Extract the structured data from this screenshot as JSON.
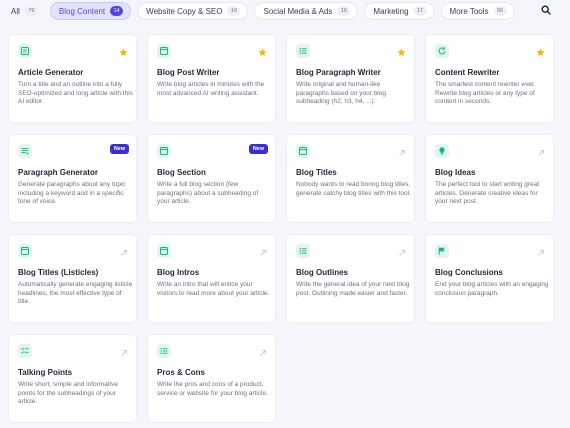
{
  "filters": [
    {
      "label": "All",
      "count": "79",
      "active": false
    },
    {
      "label": "Blog Content",
      "count": "14",
      "active": true
    },
    {
      "label": "Website Copy & SEO",
      "count": "16",
      "active": false
    },
    {
      "label": "Social Media & Ads",
      "count": "16",
      "active": false
    },
    {
      "label": "Marketing",
      "count": "17",
      "active": false
    },
    {
      "label": "More Tools",
      "count": "56",
      "active": false
    }
  ],
  "colors": {
    "accent": "#4f46e5",
    "star": "#f5b400",
    "icon_green": "#10b981",
    "badge": "#3b2fd4"
  },
  "badge_new_label": "New",
  "cards": [
    {
      "title": "Article Generator",
      "desc": "Turn a title and an outline into a fully SEO-optimized and long article with this AI editor.",
      "icon": "document-icon",
      "corner": "star"
    },
    {
      "title": "Blog Post Writer",
      "desc": "Write blog articles in minutes with the most advanced AI writing assistant.",
      "icon": "window-icon",
      "corner": "star"
    },
    {
      "title": "Blog Paragraph Writer",
      "desc": "Write original and human-like paragraphs based on your blog subheading (h2, h3, h4, ...).",
      "icon": "list-icon",
      "corner": "star"
    },
    {
      "title": "Content Rewriter",
      "desc": "The smartest content rewriter ever. Rewrite blog articles or any type of content in seconds.",
      "icon": "refresh-icon",
      "corner": "star"
    },
    {
      "title": "Paragraph Generator",
      "desc": "Generate paragraphs about any topic including a keyword and in a specific tone of voice.",
      "icon": "paragraph-icon",
      "corner": "new"
    },
    {
      "title": "Blog Section",
      "desc": "Write a full blog section (few paragraphs) about a subheading of your article.",
      "icon": "window-icon",
      "corner": "new"
    },
    {
      "title": "Blog Titles",
      "desc": "Nobody wants to read boring blog titles, generate catchy blog titles with this tool.",
      "icon": "window-icon",
      "corner": "arrow"
    },
    {
      "title": "Blog Ideas",
      "desc": "The perfect tool to start writing great articles. Generate creative ideas for your next post.",
      "icon": "bulb-icon",
      "corner": "arrow"
    },
    {
      "title": "Blog Titles (Listicles)",
      "desc": "Automatically generate engaging listicle headlines, the most effective type of title.",
      "icon": "window-icon",
      "corner": "arrow"
    },
    {
      "title": "Blog Intros",
      "desc": "Write an intro that will entice your visitors to read more about your article.",
      "icon": "window-icon",
      "corner": "arrow"
    },
    {
      "title": "Blog Outlines",
      "desc": "Write the general idea of your next blog post. Outlining made easier and faster.",
      "icon": "list-icon",
      "corner": "arrow"
    },
    {
      "title": "Blog Conclusions",
      "desc": "End your blog articles with an engaging conclusion paragraph.",
      "icon": "flag-icon",
      "corner": "arrow"
    },
    {
      "title": "Talking Points",
      "desc": "Write short, simple and informative points for the subheadings of your article.",
      "icon": "checklist-icon",
      "corner": "arrow"
    },
    {
      "title": "Pros & Cons",
      "desc": "Write the pros and cons of a product, service or website for your blog article.",
      "icon": "list-icon",
      "corner": "arrow"
    }
  ]
}
